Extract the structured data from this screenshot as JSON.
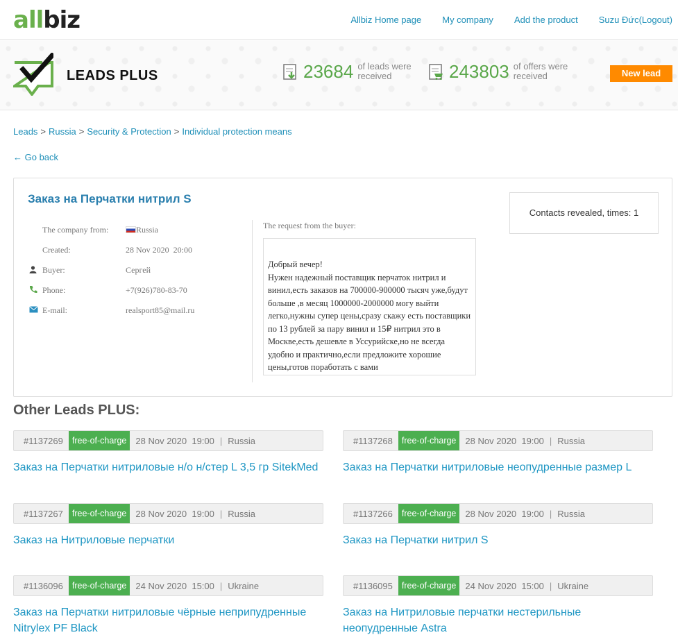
{
  "header": {
    "logo_prefix": "all",
    "logo_suffix": "biz",
    "nav": [
      "Allbiz Home page",
      "My company",
      "Add the product",
      "Suzu Đức(Logout)"
    ]
  },
  "banner": {
    "title": "LEADS PLUS",
    "leads_count": "23684",
    "leads_text": "of leads were received",
    "offers_count": "243803",
    "offers_text": "of offers were received",
    "new_lead_label": "New lead"
  },
  "breadcrumb": [
    "Leads",
    "Russia",
    "Security & Protection",
    "Individual protection means"
  ],
  "breadcrumb_sep": ">",
  "go_back": "← Go back",
  "lead": {
    "title": "Заказ на Перчатки нитрил S",
    "company_label": "The company from:",
    "country": "Russia",
    "created_label": "Created:",
    "created": "28 Nov 2020  20:00",
    "buyer_label": "Buyer:",
    "buyer": "Сергей",
    "phone_label": "Phone:",
    "phone": "+7(926)780-83-70",
    "email_label": "E-mail:",
    "email": "realsport85@mail.ru",
    "request_label": "The request from the buyer:",
    "request_text": "Добрый вечер!\nНужен надежный поставщик перчаток нитрил и винил,есть заказов на 700000-900000 тысяч уже,будут больше ,в месяц 1000000-2000000 могу выйти легко,нужны супер цены,сразу скажу есть поставщики по 13 рублей за пару винил и 15₽ нитрил это в Москве,есть дешевле в Уссурийске,но не всегда удобно и практично,если предложите хорошие цены,готов поработать с вами",
    "contacts_revealed": "Contacts revealed, times: 1"
  },
  "other": {
    "title": "Other Leads PLUS:",
    "items": [
      {
        "id": "#1137269",
        "tag": "free-of-charge",
        "when": "28 Nov 2020  19:00",
        "country": "Russia",
        "title": "Заказ на Перчатки нитриловые н/о н/стер L 3,5 гр SitekMed"
      },
      {
        "id": "#1137268",
        "tag": "free-of-charge",
        "when": "28 Nov 2020  19:00",
        "country": "Russia",
        "title": "Заказ на Перчатки нитриловые неопудренные размер L"
      },
      {
        "id": "#1137267",
        "tag": "free-of-charge",
        "when": "28 Nov 2020  19:00",
        "country": "Russia",
        "title": "Заказ на Нитриловые перчатки"
      },
      {
        "id": "#1137266",
        "tag": "free-of-charge",
        "when": "28 Nov 2020  19:00",
        "country": "Russia",
        "title": "Заказ на Перчатки нитрил S"
      },
      {
        "id": "#1136096",
        "tag": "free-of-charge",
        "when": "24 Nov 2020  15:00",
        "country": "Ukraine",
        "title": "Заказ на Перчатки нитриловые чёрные неприпудренные Nitrylex PF Black"
      },
      {
        "id": "#1136095",
        "tag": "free-of-charge",
        "when": "24 Nov 2020  15:00",
        "country": "Ukraine",
        "title": "Заказ на Нитриловые перчатки нестерильные неопудренные Astra"
      }
    ]
  },
  "icons": {
    "buyer": "user-icon",
    "phone": "phone-icon",
    "email": "envelope-icon",
    "leads": "document-arrow-icon",
    "offers": "document-cart-icon"
  },
  "colors": {
    "link": "#1e8fb8",
    "brand_green": "#6ab04c",
    "accent_orange": "#ff8a00",
    "tag_green": "#4caf50"
  }
}
